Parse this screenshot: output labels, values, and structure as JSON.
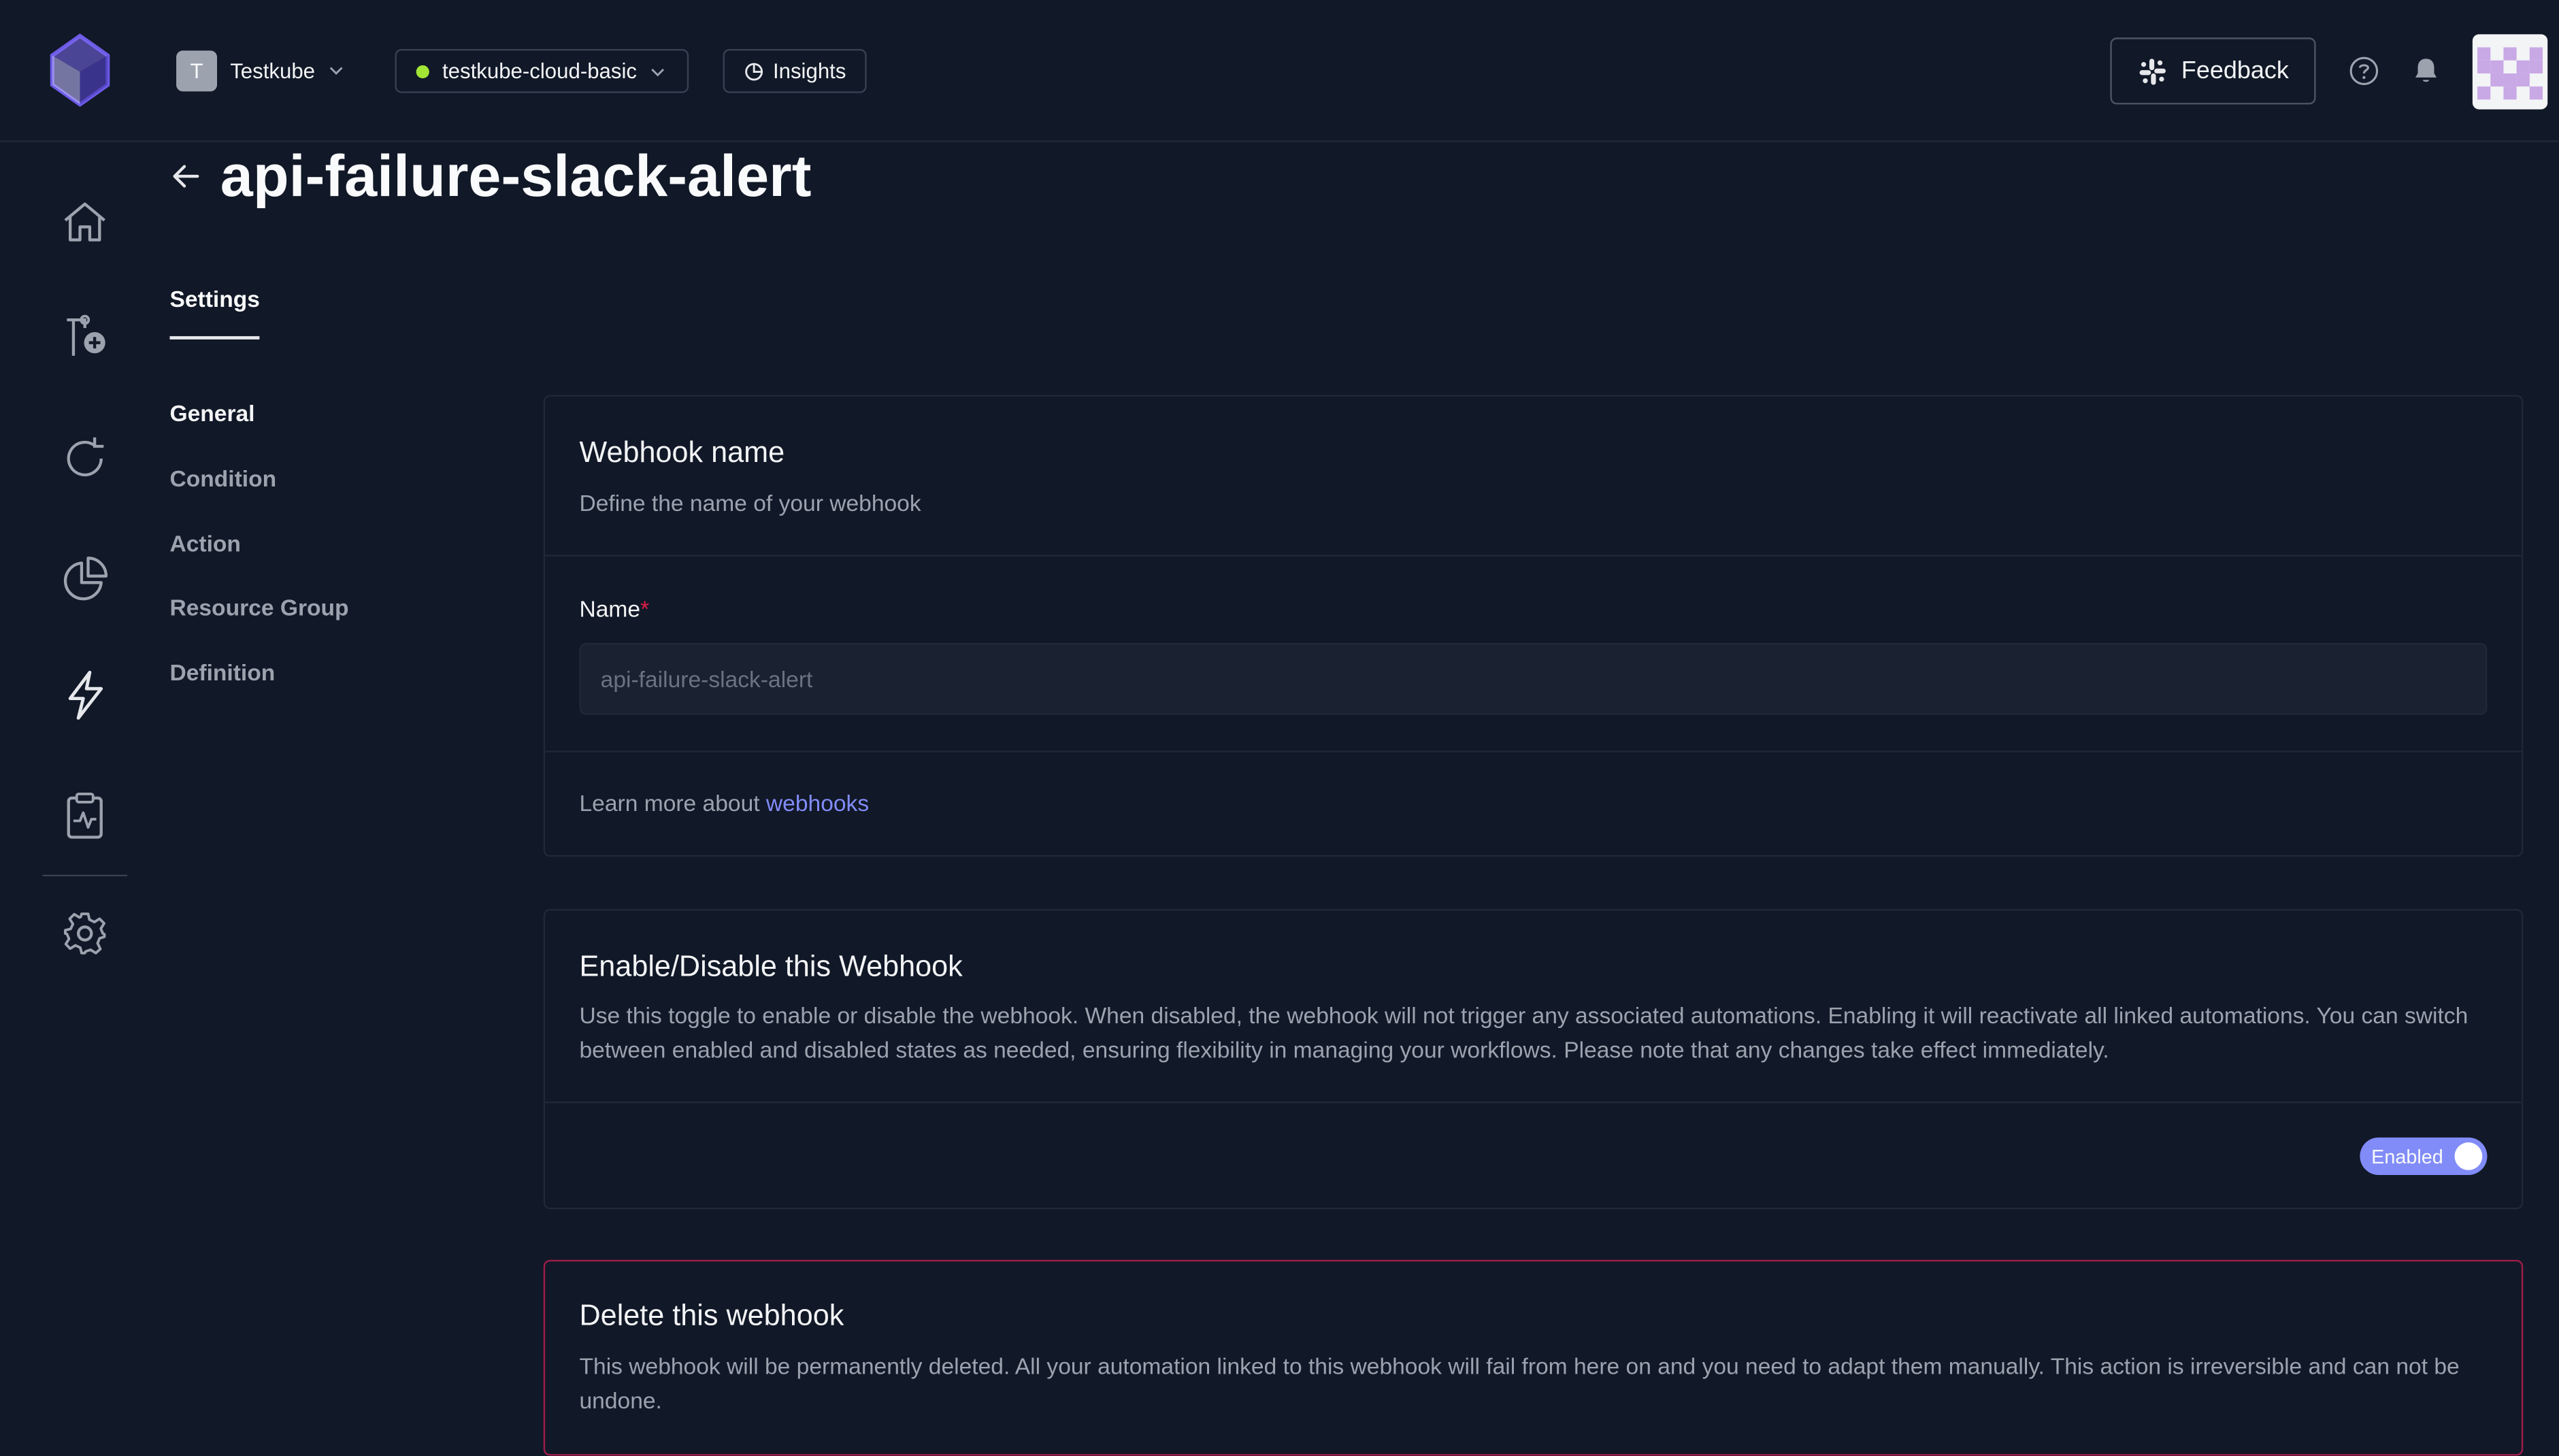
{
  "header": {
    "org": {
      "initial": "T",
      "name": "Testkube"
    },
    "environment": {
      "name": "testkube-cloud-basic",
      "status_color": "#a3e635"
    },
    "insights_label": "Insights",
    "feedback_label": "Feedback"
  },
  "sidebar": {
    "items": [
      {
        "name": "home",
        "icon": "home-icon"
      },
      {
        "name": "test-workflows",
        "icon": "workflow-add-icon"
      },
      {
        "name": "executions",
        "icon": "refresh-icon"
      },
      {
        "name": "insights",
        "icon": "pie-chart-icon"
      },
      {
        "name": "webhooks",
        "icon": "lightning-icon",
        "active": true
      },
      {
        "name": "status-pages",
        "icon": "clipboard-pulse-icon"
      },
      {
        "name": "settings",
        "icon": "gear-icon"
      }
    ]
  },
  "page": {
    "title": "api-failure-slack-alert",
    "tab": "Settings",
    "subnav": [
      "General",
      "Condition",
      "Action",
      "Resource Group",
      "Definition"
    ]
  },
  "webhook_name_card": {
    "title": "Webhook name",
    "description": "Define the name of your webhook",
    "field_label": "Name",
    "required_marker": "*",
    "value": "api-failure-slack-alert",
    "learn_prefix": "Learn more about ",
    "learn_link": "webhooks"
  },
  "toggle_card": {
    "title": "Enable/Disable this Webhook",
    "description": "Use this toggle to enable or disable the webhook. When disabled, the webhook will not trigger any associated automations. Enabling it will reactivate all linked automations. You can switch between enabled and disabled states as needed, ensuring flexibility in managing your workflows. Please note that any changes take effect immediately.",
    "toggle_label": "Enabled"
  },
  "delete_card": {
    "title": "Delete this webhook",
    "description": "This webhook will be permanently deleted. All your automation linked to this webhook will fail from here on and you need to adapt them manually. This action is irreversible and can not be undone."
  },
  "colors": {
    "background": "#111827",
    "accent": "#818cf8",
    "danger_border": "#9f1d4b"
  }
}
